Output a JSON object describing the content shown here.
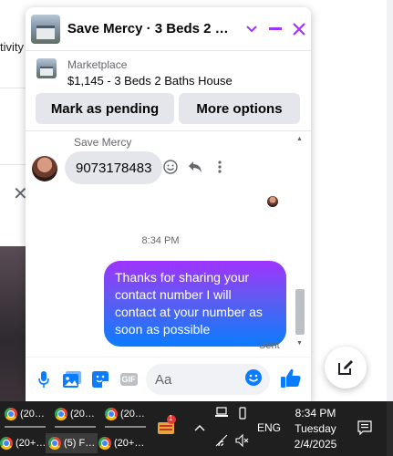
{
  "background": {
    "activity_text": "tivity"
  },
  "chat": {
    "title": "Save Mercy · 3 Beds 2 Bath…",
    "marketplace": {
      "label": "Marketplace",
      "listing": "$1,145 - 3 Beds 2 Baths House"
    },
    "buttons": {
      "mark_pending": "Mark as pending",
      "more_options": "More options"
    },
    "messages": {
      "sender_name": "Save Mercy",
      "incoming_text": "9073178483",
      "timestamp": "8:34 PM",
      "outgoing_text": "Thanks for sharing your contact number I will contact at your number as soon as possible",
      "status": "Sent"
    },
    "composer": {
      "placeholder": "Aa",
      "gif_label": "GIF"
    }
  },
  "taskbar": {
    "items_top": [
      "(20…",
      "(20…",
      "(20…"
    ],
    "items_bottom": [
      "(20+…",
      "(5) F…",
      "(20+…"
    ],
    "badge_count": "1",
    "language": "ENG",
    "time": "8:34 PM",
    "day": "Tuesday",
    "date": "2/4/2025"
  },
  "colors": {
    "accent": "#a033ff",
    "messenger_blue": "#0a7cff",
    "bubble_gray": "#e4e6eb",
    "taskbar": "#1f1f1f"
  }
}
